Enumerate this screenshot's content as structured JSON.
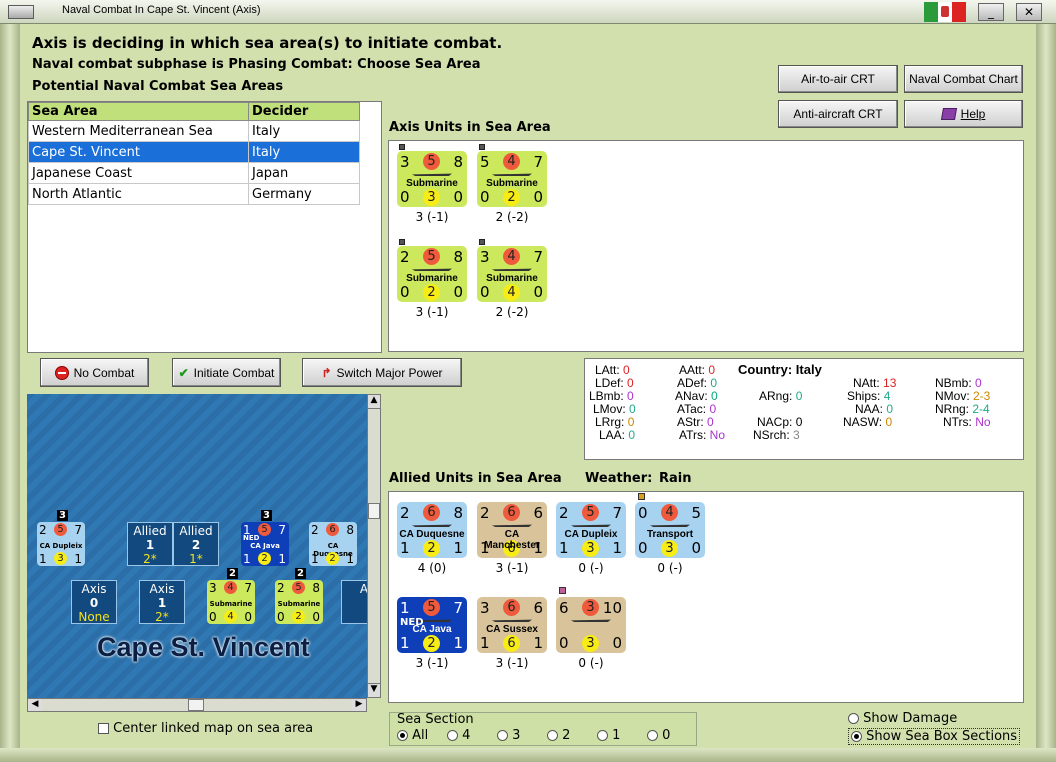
{
  "window": {
    "title": "Naval Combat In Cape St. Vincent (Axis)"
  },
  "header": {
    "main": "Axis is deciding in which sea area(s) to initiate combat.",
    "subphase": "Naval combat subphase is Phasing Combat: Choose Sea Area",
    "areas_title": "Potential Naval Combat Sea Areas"
  },
  "sea_table": {
    "headers": [
      "Sea Area",
      "Decider"
    ],
    "rows": [
      {
        "area": "Western Mediterranean Sea",
        "decider": "Italy"
      },
      {
        "area": "Cape St. Vincent",
        "decider": "Italy"
      },
      {
        "area": "Japanese Coast",
        "decider": "Japan"
      },
      {
        "area": "North Atlantic",
        "decider": "Germany"
      }
    ],
    "selected_index": 1
  },
  "top_buttons": {
    "air_crt": "Air-to-air CRT",
    "naval_chart": "Naval Combat Chart",
    "aa_crt": "Anti-aircraft CRT",
    "help": "Help"
  },
  "axis_units": {
    "title": "Axis Units in Sea Area",
    "units": [
      {
        "a": "3",
        "b": "5",
        "c": "8",
        "name": "Submarine",
        "d": "0",
        "e": "3",
        "f": "0",
        "below": "3 (-1)"
      },
      {
        "a": "5",
        "b": "4",
        "c": "7",
        "name": "Submarine",
        "d": "0",
        "e": "2",
        "f": "0",
        "below": "2 (-2)"
      },
      {
        "a": "2",
        "b": "5",
        "c": "8",
        "name": "Submarine",
        "d": "0",
        "e": "2",
        "f": "0",
        "below": "3 (-1)"
      },
      {
        "a": "3",
        "b": "4",
        "c": "7",
        "name": "Submarine",
        "d": "0",
        "e": "4",
        "f": "0",
        "below": "2 (-2)"
      }
    ]
  },
  "action_buttons": {
    "no_combat": "No Combat",
    "initiate": "Initiate Combat",
    "switch": "Switch Major Power"
  },
  "stats": {
    "country_label": "Country:",
    "country": "Italy",
    "latt": "0",
    "ldef": "0",
    "lbmb": "0",
    "lmov": "0",
    "lrrg": "0",
    "laa": "0",
    "aatt": "0",
    "adef": "0",
    "anav": "0",
    "atac": "0",
    "astr": "0",
    "atrs": "No",
    "arng": "0",
    "nacp": "0",
    "nsrch": "3",
    "natt": "13",
    "ships": "4",
    "naa": "0",
    "nasw": "0",
    "nbmb": "0",
    "nmov": "2-3",
    "nrng": "2-4",
    "ntrs": "No"
  },
  "allied_units": {
    "title": "Allied Units in Sea Area",
    "weather_label": "Weather:",
    "weather": "Rain",
    "units": [
      {
        "a": "2",
        "b": "6",
        "c": "8",
        "name": "CA Duquesne",
        "d": "1",
        "e": "2",
        "f": "1",
        "below": "4 (0)",
        "style": "lblue"
      },
      {
        "a": "2",
        "b": "6",
        "c": "6",
        "name": "CA Manchester",
        "d": "1",
        "e": "6",
        "f": "1",
        "below": "3 (-1)",
        "style": "tan"
      },
      {
        "a": "2",
        "b": "5",
        "c": "7",
        "name": "CA Dupleix",
        "d": "1",
        "e": "3",
        "f": "1",
        "below": "0 (-)",
        "style": "lblue"
      },
      {
        "a": "0",
        "b": "4",
        "c": "5",
        "name": "Transport",
        "d": "0",
        "e": "3",
        "f": "0",
        "below": "0 (-)",
        "style": "lblue"
      },
      {
        "a": "1",
        "b": "5",
        "c": "7",
        "name": "CA Java",
        "tag": "NED",
        "d": "1",
        "e": "2",
        "f": "1",
        "below": "3 (-1)",
        "style": "ned"
      },
      {
        "a": "3",
        "b": "6",
        "c": "6",
        "name": "CA Sussex",
        "d": "1",
        "e": "6",
        "f": "1",
        "below": "3 (-1)",
        "style": "tan"
      },
      {
        "a": "6",
        "b": "3",
        "c": "10",
        "name": "",
        "d": "0",
        "e": "3",
        "f": "0",
        "below": "0 (-)",
        "style": "tan"
      }
    ]
  },
  "map": {
    "sea_name": "Cape St. Vincent",
    "boxes": [
      {
        "label": "Allied",
        "num": "1",
        "val": "2*"
      },
      {
        "label": "Allied",
        "num": "2",
        "val": "1*"
      },
      {
        "label": "Axis",
        "num": "0",
        "val": "None"
      },
      {
        "label": "Axis",
        "num": "1",
        "val": "2*"
      },
      {
        "label": "A",
        "num": "",
        "val": ""
      }
    ],
    "counters": [
      {
        "stack": "3",
        "a": "2",
        "b": "5",
        "c": "7",
        "name": "CA Dupleix",
        "d": "1",
        "e": "3",
        "f": "1"
      },
      {
        "stack": "3",
        "a": "1",
        "b": "5",
        "c": "7",
        "name": "CA Java",
        "tag": "NED",
        "d": "1",
        "e": "2",
        "f": "1"
      },
      {
        "stack": "",
        "a": "2",
        "b": "6",
        "c": "8",
        "name": "CA Duquesne",
        "d": "1",
        "e": "2",
        "f": "1"
      },
      {
        "stack": "2",
        "a": "3",
        "b": "4",
        "c": "7",
        "name": "Submarine",
        "d": "0",
        "e": "4",
        "f": "0"
      },
      {
        "stack": "2",
        "a": "2",
        "b": "5",
        "c": "8",
        "name": "Submarine",
        "d": "0",
        "e": "2",
        "f": "0"
      }
    ]
  },
  "bottom": {
    "center_map": "Center linked map on sea area",
    "sea_section_title": "Sea Section",
    "sections": [
      "All",
      "4",
      "3",
      "2",
      "1",
      "0"
    ],
    "show_damage": "Show Damage",
    "show_boxes": "Show Sea Box Sections"
  },
  "colors": {
    "selected_row": "#1a6fd8",
    "submarine": "#cce85c",
    "allied_blue": "#a8d3f0",
    "allied_tan": "#d8c39a",
    "ned": "#0f3fb8"
  }
}
